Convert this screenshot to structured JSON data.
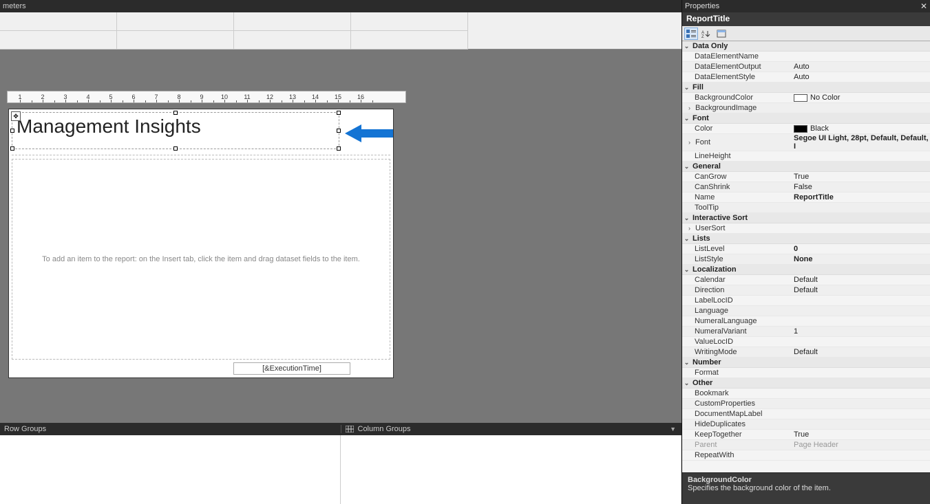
{
  "topbar": {
    "tab_partial": "meters"
  },
  "canvas": {
    "title_text": "Management Insights",
    "body_hint": "To add an item to the report: on the Insert tab, click the item and drag dataset fields to the item.",
    "footer_expr": "[&ExecutionTime]"
  },
  "ruler": {
    "labels": [
      "1",
      "2",
      "3",
      "4",
      "5",
      "6",
      "7",
      "8",
      "9",
      "10",
      "11",
      "12",
      "13",
      "14",
      "15",
      "16"
    ]
  },
  "groups": {
    "row_label": "Row Groups",
    "col_label": "Column Groups"
  },
  "properties": {
    "panel_title": "Properties",
    "object_name": "ReportTitle",
    "description": {
      "title": "BackgroundColor",
      "text": "Specifies the background color of the item."
    },
    "categories": [
      {
        "name": "Data Only",
        "props": [
          {
            "n": "DataElementName",
            "v": ""
          },
          {
            "n": "DataElementOutput",
            "v": "Auto"
          },
          {
            "n": "DataElementStyle",
            "v": "Auto"
          }
        ]
      },
      {
        "name": "Fill",
        "props": [
          {
            "n": "BackgroundColor",
            "v": "No Color",
            "swatch": "nocolor",
            "selected": true
          },
          {
            "n": "BackgroundImage",
            "v": "",
            "expandable": true,
            "collapsed": true
          }
        ]
      },
      {
        "name": "Font",
        "props": [
          {
            "n": "Color",
            "v": "Black",
            "swatch": "black"
          },
          {
            "n": "Font",
            "v": "Segoe UI Light, 28pt, Default, Default, I",
            "bold": true,
            "expandable": true,
            "collapsed": true
          },
          {
            "n": "LineHeight",
            "v": ""
          }
        ]
      },
      {
        "name": "General",
        "props": [
          {
            "n": "CanGrow",
            "v": "True"
          },
          {
            "n": "CanShrink",
            "v": "False"
          },
          {
            "n": "Name",
            "v": "ReportTitle",
            "bold": true
          },
          {
            "n": "ToolTip",
            "v": ""
          }
        ]
      },
      {
        "name": "Interactive Sort",
        "props": [
          {
            "n": "UserSort",
            "v": "",
            "expandable": true,
            "collapsed": true
          }
        ]
      },
      {
        "name": "Lists",
        "props": [
          {
            "n": "ListLevel",
            "v": "0",
            "bold": true
          },
          {
            "n": "ListStyle",
            "v": "None",
            "bold": true
          }
        ]
      },
      {
        "name": "Localization",
        "props": [
          {
            "n": "Calendar",
            "v": "Default"
          },
          {
            "n": "Direction",
            "v": "Default"
          },
          {
            "n": "LabelLocID",
            "v": ""
          },
          {
            "n": "Language",
            "v": ""
          },
          {
            "n": "NumeralLanguage",
            "v": ""
          },
          {
            "n": "NumeralVariant",
            "v": "1"
          },
          {
            "n": "ValueLocID",
            "v": ""
          },
          {
            "n": "WritingMode",
            "v": "Default"
          }
        ]
      },
      {
        "name": "Number",
        "props": [
          {
            "n": "Format",
            "v": ""
          }
        ]
      },
      {
        "name": "Other",
        "props": [
          {
            "n": "Bookmark",
            "v": ""
          },
          {
            "n": "CustomProperties",
            "v": ""
          },
          {
            "n": "DocumentMapLabel",
            "v": ""
          },
          {
            "n": "HideDuplicates",
            "v": ""
          },
          {
            "n": "KeepTogether",
            "v": "True"
          },
          {
            "n": "Parent",
            "v": "Page Header",
            "disabled": true
          },
          {
            "n": "RepeatWith",
            "v": ""
          }
        ]
      }
    ]
  }
}
